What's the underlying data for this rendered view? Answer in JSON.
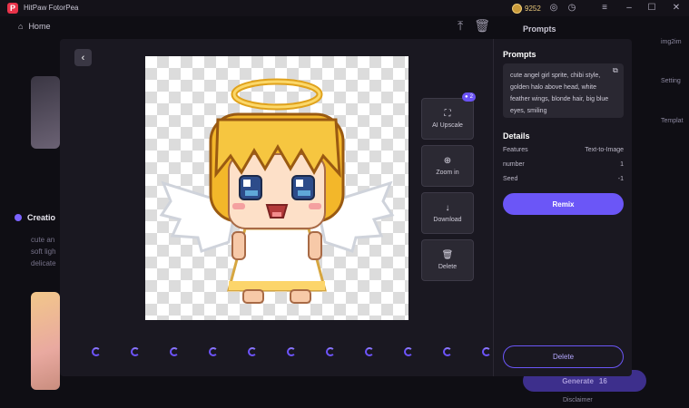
{
  "app": {
    "title": "HitPaw FotorPea",
    "logo_letter": "P",
    "coins": "9252"
  },
  "background": {
    "home_label": "Home",
    "creation_label": "Creatio",
    "creation_lines": [
      "cute an",
      "soft ligh",
      "delicate"
    ],
    "right_header": "Prompts",
    "side_items": [
      "img2im",
      "Setting",
      "Templat"
    ],
    "generate_label": "Generate",
    "generate_cost": "16",
    "disclaimer": "Disclaimer"
  },
  "modal": {
    "tools": [
      {
        "name": "ai-upscale",
        "label": "AI Upscale",
        "icon": "expand-icon"
      },
      {
        "name": "zoom-in",
        "label": "Zoom in",
        "icon": "zoom-in-icon"
      },
      {
        "name": "download",
        "label": "Download",
        "icon": "download-icon"
      },
      {
        "name": "delete",
        "label": "Delete",
        "icon": "trash-icon"
      }
    ],
    "upscale_badge": "2",
    "spinner_count": 11
  },
  "panel": {
    "prompts_title": "Prompts",
    "prompt_text": "cute angel girl sprite, chibi style, golden halo above head, white feather wings, blonde hair, big blue eyes, smiling",
    "details_title": "Details",
    "details": [
      {
        "key": "Features",
        "value": "Text-to-Image"
      },
      {
        "key": "number",
        "value": "1"
      },
      {
        "key": "Seed",
        "value": "-1"
      }
    ],
    "remix_label": "Remix",
    "delete_label": "Delete"
  },
  "colors": {
    "accent": "#6b56f7",
    "modal_bg": "#1a1821",
    "page_bg": "#0f0e14"
  }
}
